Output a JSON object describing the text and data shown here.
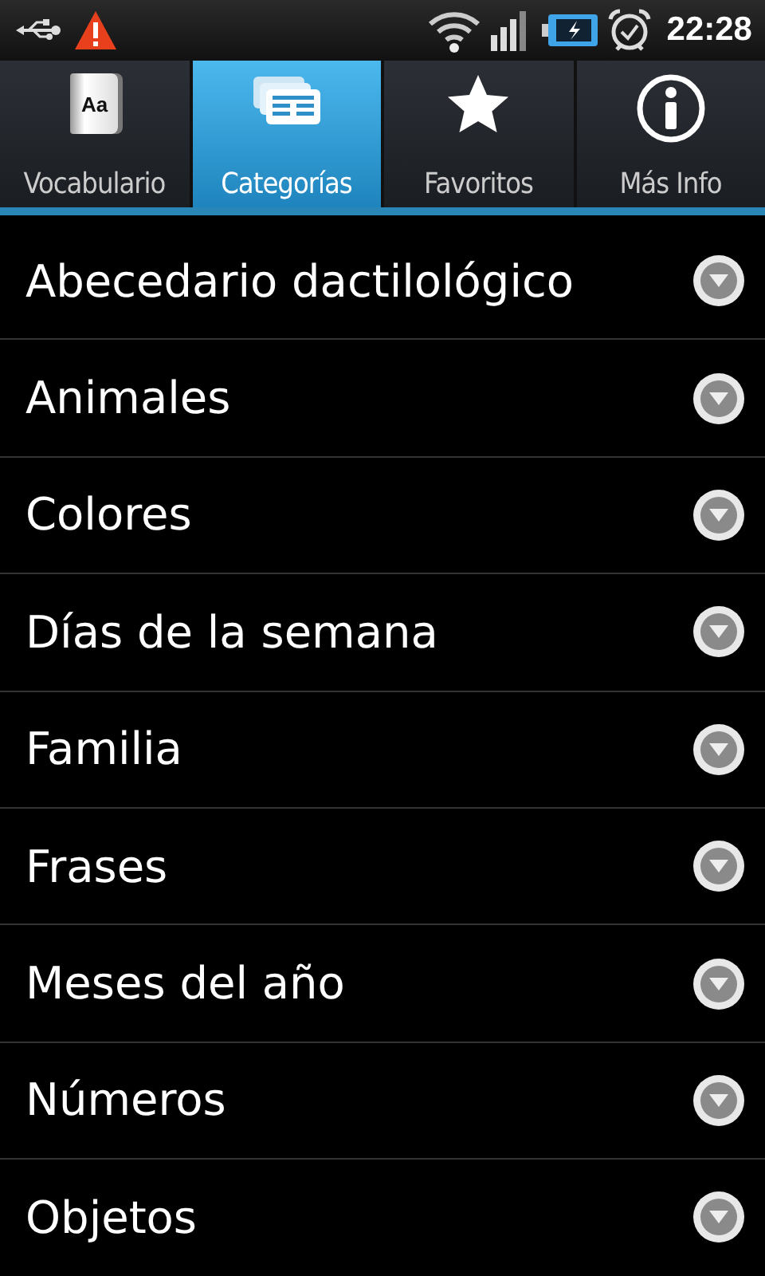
{
  "status_bar": {
    "time": "22:28"
  },
  "tabs": [
    {
      "label": "Vocabulario",
      "kind": "book",
      "icon_text": "Aa",
      "selected": false
    },
    {
      "label": "Categorías",
      "kind": "cards",
      "selected": true
    },
    {
      "label": "Favoritos",
      "kind": "star",
      "selected": false
    },
    {
      "label": "Más Info",
      "kind": "info",
      "selected": false
    }
  ],
  "categories": [
    {
      "label": "Abecedario dactilológico"
    },
    {
      "label": "Animales"
    },
    {
      "label": "Colores"
    },
    {
      "label": "Días de la semana"
    },
    {
      "label": "Familia"
    },
    {
      "label": "Frases"
    },
    {
      "label": "Meses del año"
    },
    {
      "label": "Números"
    },
    {
      "label": "Objetos"
    }
  ]
}
